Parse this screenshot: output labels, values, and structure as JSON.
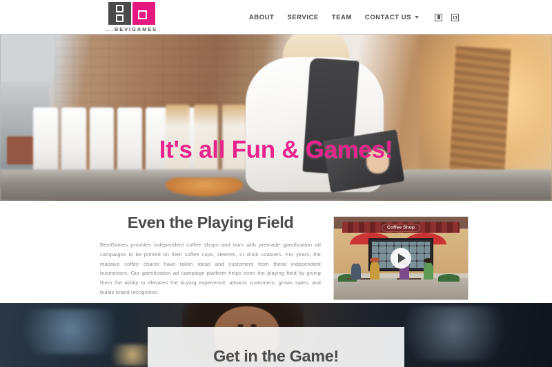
{
  "header": {
    "brand": {
      "name": "...BEVIGAMES",
      "logo_gray_color": "#4a4a4a",
      "logo_pink_color": "#e6187f"
    },
    "nav": [
      {
        "label": "ABOUT"
      },
      {
        "label": "SERVICE"
      },
      {
        "label": "TEAM"
      },
      {
        "label": "CONTACT US",
        "has_dropdown": true
      }
    ],
    "social_icons": [
      {
        "name": "facebook-icon"
      },
      {
        "name": "instagram-icon"
      }
    ]
  },
  "hero": {
    "headline": "It's all Fun & Games!",
    "headline_color": "#e8238c",
    "image_alt": "barista in coffee bar"
  },
  "content": {
    "section_title": "Even the Playing Field",
    "body": "BeviGames provides independent coffee shops and bars with premade gamification ad campaigns to be printed on their coffee cups, sleeves, or drink coasters. For years, the massive coffee chains have taken ideas and customers from these independent businesses. Our gamification ad campaign platform helps even the playing field by giving them the ability to elevates the buying experience, attracts customers, grows sales, and builds brand recognition.",
    "video": {
      "sign_label": "Coffee Shop",
      "play_icon": "play-icon"
    }
  },
  "bottom": {
    "section_title": "Get in the Game!"
  }
}
